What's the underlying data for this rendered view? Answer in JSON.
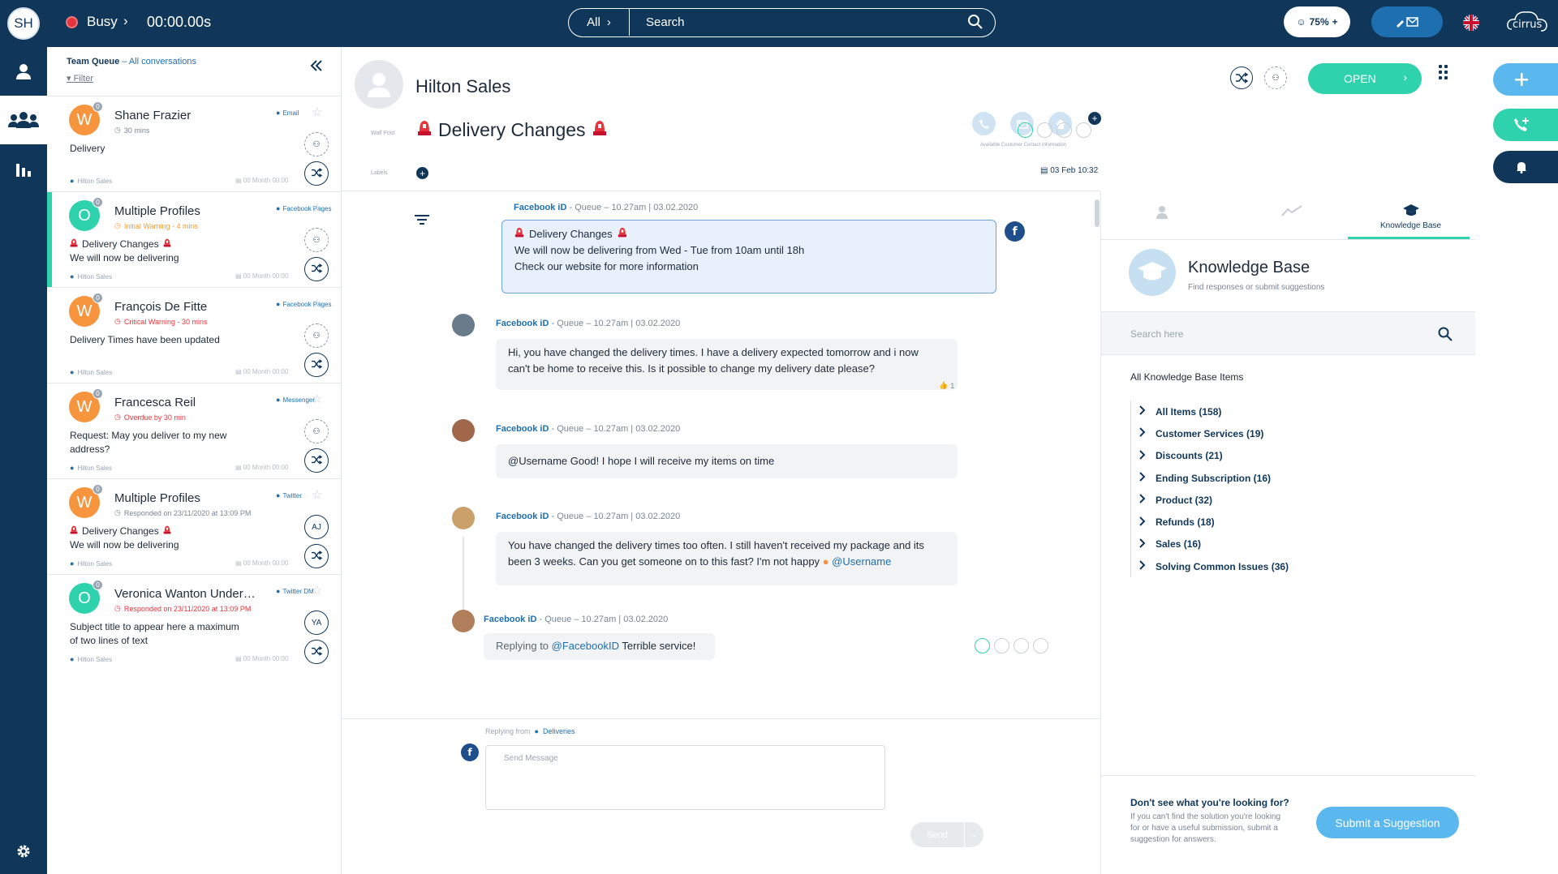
{
  "topbar": {
    "user_initials": "SH",
    "status": "Busy",
    "timer": "00:00.00s",
    "search_scope": "All",
    "search_placeholder": "Search",
    "mood_value": "75%",
    "logo": "cirrus"
  },
  "rail": {
    "items": [
      "person-icon",
      "team-icon",
      "stats-icon"
    ],
    "settings": "gear-icon"
  },
  "queue": {
    "title": "Team Queue",
    "subtitle": "All conversations",
    "filter_label": "Filter",
    "conversations": [
      {
        "initial": "W",
        "avatar_color": "#f7943e",
        "count": "0",
        "name": "Shane Frazier",
        "sub": "30 mins",
        "sub_type": "normal",
        "channel": "Email",
        "body": "Delivery",
        "foot": "Hilton Sales",
        "date": "00 Month 00:00",
        "mid_circle": "",
        "selected": false
      },
      {
        "initial": "O",
        "avatar_color": "#2ed3ad",
        "count": "0",
        "name": "Multiple Profiles",
        "sub": "Initial Warning - 4 mins",
        "sub_type": "warn",
        "channel": "Facebook Pages",
        "body_subject": "Delivery Changes",
        "body": "We will now be delivering",
        "foot": "Hilton Sales",
        "date": "00 Month 00:00",
        "mid_circle": "",
        "selected": true
      },
      {
        "initial": "W",
        "avatar_color": "#f7943e",
        "count": "0",
        "name": "François De Fitte",
        "sub": "Critical Warning - 30 mins",
        "sub_type": "crit",
        "channel": "Facebook Pages",
        "body": "Delivery Times have been updated",
        "foot": "Hilton Sales",
        "date": "00 Month 00:00",
        "mid_circle": "",
        "selected": false
      },
      {
        "initial": "W",
        "avatar_color": "#f7943e",
        "count": "0",
        "name": "Francesca Reil",
        "sub": "Overdue by 30 min",
        "sub_type": "crit",
        "channel": "Messenger",
        "body": "Request: May you deliver to my new address?",
        "foot": "Hilton Sales",
        "date": "00 Month 00:00",
        "mid_circle": "",
        "selected": false
      },
      {
        "initial": "W",
        "avatar_color": "#f7943e",
        "count": "0",
        "name": "Multiple Profiles",
        "sub": "Responded on 23/11/2020 at 13:09 PM",
        "sub_type": "normal",
        "channel": "Twitter",
        "body_subject": "Delivery Changes",
        "body": "We will now be delivering",
        "foot": "Hilton Sales",
        "date": "00 Month 00:00",
        "mid_circle": "AJ",
        "selected": false
      },
      {
        "initial": "O",
        "avatar_color": "#2ed3ad",
        "count": "0",
        "name": "Veronica Wanton Underwood",
        "sub": "Responded on 23/11/2020 at 13:09 PM",
        "sub_type": "crit",
        "channel": "Twitter DM",
        "body": "Subject title to appear here a maximum of two lines of text",
        "foot": "Hilton Sales",
        "date": "00 Month 00:00",
        "mid_circle": "YA",
        "selected": false
      }
    ]
  },
  "conversation": {
    "contact_name": "Hilton Sales",
    "wall_post_label": "Wall Post",
    "labels_label": "Labels",
    "subject": "Delivery Changes",
    "contact_info_caption": "Available Customer Contact Information",
    "date": "03 Feb 10:32",
    "open_label": "OPEN",
    "messages": [
      {
        "author": "Facebook iD",
        "meta": "Queue – 10.27am | 03.02.2020",
        "lines": [
          "Delivery Changes",
          "We will now be delivering from Wed - Tue from 10am until 18h",
          "Check our website for more information"
        ],
        "outgoing": true
      },
      {
        "author": "Facebook iD",
        "meta": "Queue – 10.27am | 03.02.2020",
        "lines": [
          "Hi, you have changed the delivery times. I have a delivery expected tomorrow and i now",
          "can't be home to receive this. Is it possible to change my delivery date please?"
        ],
        "likes": "1"
      },
      {
        "author": "Facebook iD",
        "meta": "Queue – 10.27am | 03.02.2020",
        "lines": [
          "@Username Good! I hope I will receive my items on time"
        ]
      },
      {
        "author": "Facebook iD",
        "meta": "Queue – 10.27am | 03.02.2020",
        "lines": [
          "You have changed the delivery times too often. I still haven't received my package and its",
          "been 3 weeks. Can you get someone on to this fast? I'm not happy"
        ],
        "mention": "@Username"
      },
      {
        "author": "Facebook iD",
        "meta": "Queue – 10.27am | 03.02.2020",
        "reply_prefix": "Replying to",
        "reply_mention": "@FacebookID",
        "reply_text": "Terrible service!"
      }
    ],
    "compose": {
      "replying_from_label": "Replying from",
      "replying_from_value": "Deliveries",
      "placeholder": "Send Message",
      "send_label": "Send"
    }
  },
  "knowledge_base": {
    "tab_label": "Knowledge Base",
    "title": "Knowledge Base",
    "subtitle": "Find responses or submit suggestions",
    "search_placeholder": "Search here",
    "all_label": "All Knowledge Base Items",
    "items": [
      "All Items (158)",
      "Customer Services (19)",
      "Discounts (21)",
      "Ending Subscription (16)",
      "Product (32)",
      "Refunds (18)",
      "Sales (16)",
      "Solving Common Issues (36)"
    ],
    "footer_question": "Don't see what you're looking for?",
    "footer_text": "If you can't find the solution you're looking for or have a useful submission, submit a suggestion for answers.",
    "suggest_label": "Submit a Suggestion"
  },
  "colors": {
    "navy": "#10375a",
    "teal": "#2ed3ad",
    "blue": "#1d6fb0",
    "orange": "#f7943e",
    "red": "#e5343b"
  }
}
